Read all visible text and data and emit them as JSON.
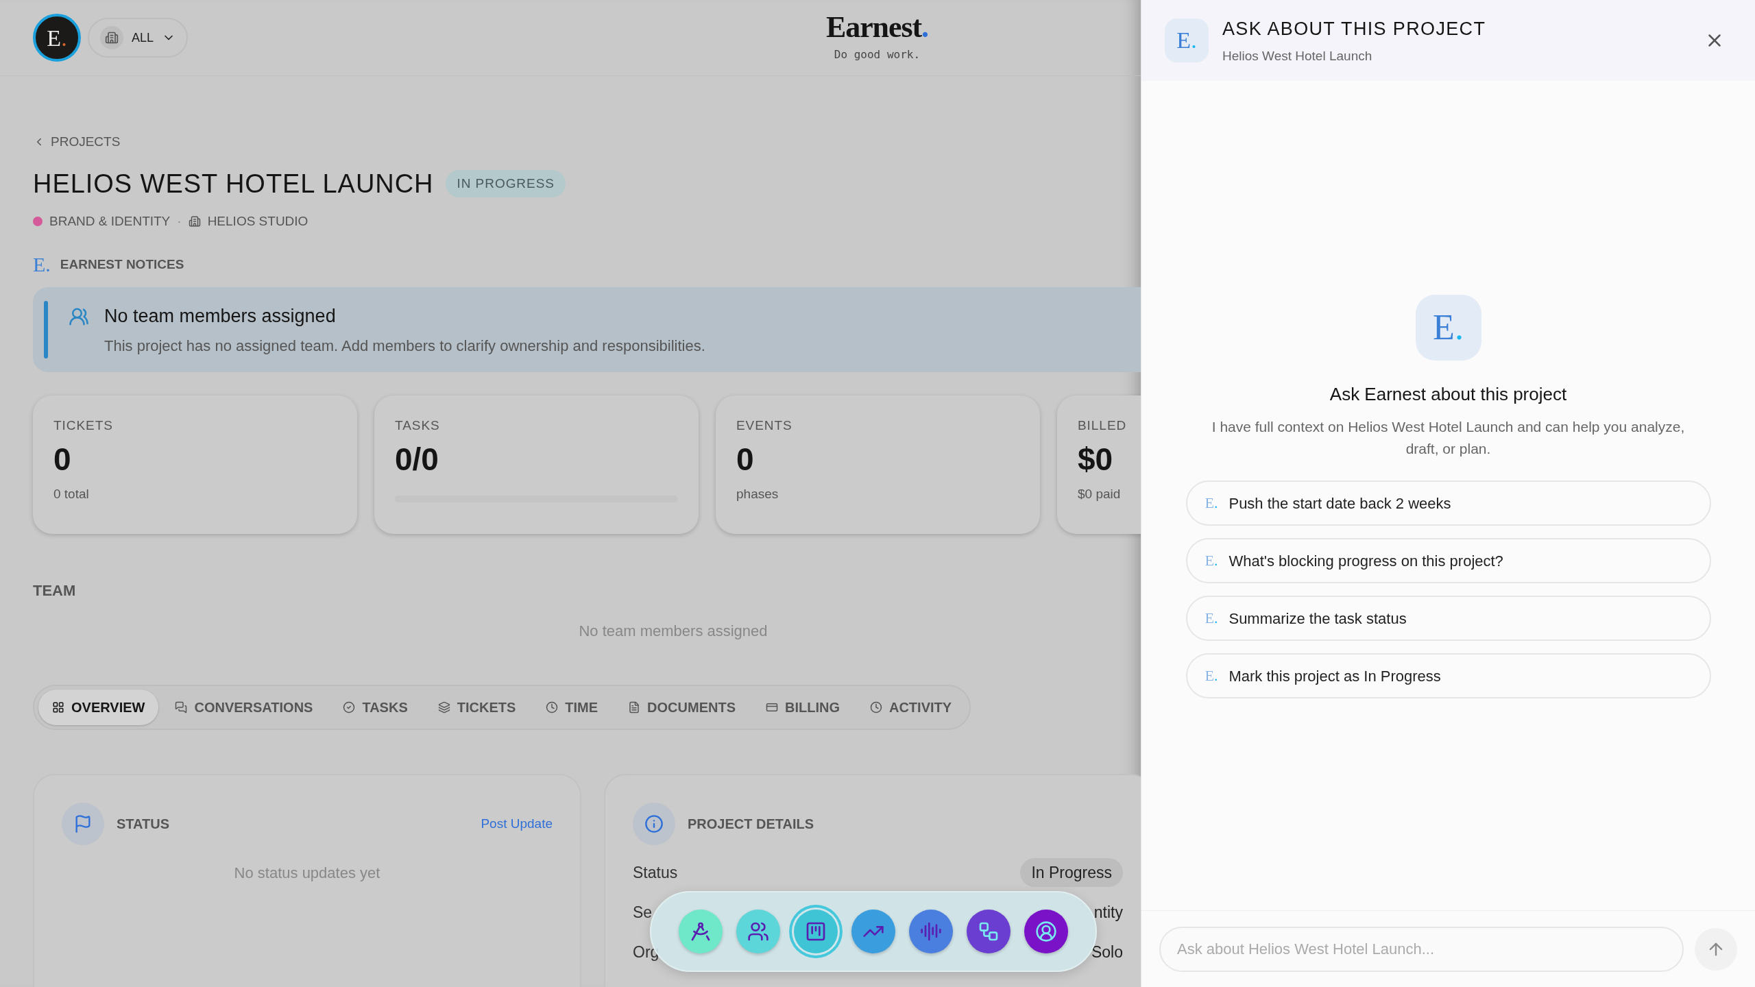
{
  "header": {
    "avatar": {
      "letter": "E",
      "dot": "."
    },
    "filter": "ALL",
    "logo": {
      "name": "Earnest",
      "dot": ".",
      "tagline": "Do good work."
    }
  },
  "breadcrumb": "PROJECTS",
  "project": {
    "title": "HELIOS WEST HOTEL LAUNCH",
    "status": "IN PROGRESS",
    "category": {
      "label": "BRAND & IDENTITY",
      "color": "#d45a9a"
    },
    "separator": "·",
    "client": "HELIOS STUDIO"
  },
  "notices": {
    "logo": {
      "letter": "E",
      "dot": "."
    },
    "heading": "EARNEST NOTICES",
    "items": [
      {
        "title": "No team members assigned",
        "body": "This project has no assigned team. Add members to clarify ownership and responsibilities."
      }
    ]
  },
  "stats": [
    {
      "kind": "text",
      "label": "TICKETS",
      "value": "0",
      "sub": "0 total"
    },
    {
      "kind": "progress",
      "label": "TASKS",
      "value": "0/0",
      "level": 0
    },
    {
      "kind": "text",
      "label": "EVENTS",
      "value": "0",
      "sub": "phases"
    },
    {
      "kind": "text",
      "label": "BILLED",
      "value": "$0",
      "sub": "$0 paid"
    }
  ],
  "team": {
    "heading": "TEAM",
    "empty": "No team members assigned"
  },
  "tabs": [
    {
      "label": "OVERVIEW",
      "selected": true
    },
    {
      "label": "CONVERSATIONS",
      "selected": false
    },
    {
      "label": "TASKS",
      "selected": false
    },
    {
      "label": "TICKETS",
      "selected": false
    },
    {
      "label": "TIME",
      "selected": false
    },
    {
      "label": "DOCUMENTS",
      "selected": false
    },
    {
      "label": "BILLING",
      "selected": false
    },
    {
      "label": "ACTIVITY",
      "selected": false
    }
  ],
  "status_card": {
    "title": "STATUS",
    "action": "Post Update",
    "empty": "No status updates yet"
  },
  "details_card": {
    "title": "PROJECT DETAILS",
    "rows": [
      {
        "label": "Status",
        "value": "In Progress",
        "kind": "pill"
      },
      {
        "label": "Se",
        "value": "ntity",
        "kind": "plain"
      },
      {
        "label": "Org",
        "value": "Solo",
        "kind": "plain"
      }
    ]
  },
  "dock": {
    "items": [
      {
        "color": "#6ee8c8",
        "selected": false
      },
      {
        "color": "#5cd6d8",
        "selected": false
      },
      {
        "color": "#3fc4d6",
        "selected": true
      },
      {
        "color": "#3a9ede",
        "selected": false
      },
      {
        "color": "#4a7fe0",
        "selected": false
      },
      {
        "color": "#6a3ed0",
        "selected": false
      },
      {
        "color": "#7a12c8",
        "selected": false
      }
    ]
  },
  "panel": {
    "logo": {
      "letter": "E",
      "dot": "."
    },
    "title": "ASK ABOUT THIS PROJECT",
    "subtitle": "Helios West Hotel Launch",
    "intro_logo": {
      "letter": "E",
      "dot": "."
    },
    "intro_title": "Ask Earnest about this project",
    "intro_text": "I have full context on Helios West Hotel Launch and can help you analyze, draft, or plan.",
    "suggestions": [
      {
        "letter": "E",
        "dot": ".",
        "text": "Push the start date back 2 weeks"
      },
      {
        "letter": "E",
        "dot": ".",
        "text": "What's blocking progress on this project?"
      },
      {
        "letter": "E",
        "dot": ".",
        "text": "Summarize the task status"
      },
      {
        "letter": "E",
        "dot": ".",
        "text": "Mark this project as In Progress"
      }
    ],
    "input": {
      "placeholder": "Ask about Helios West Hotel Launch..."
    }
  }
}
